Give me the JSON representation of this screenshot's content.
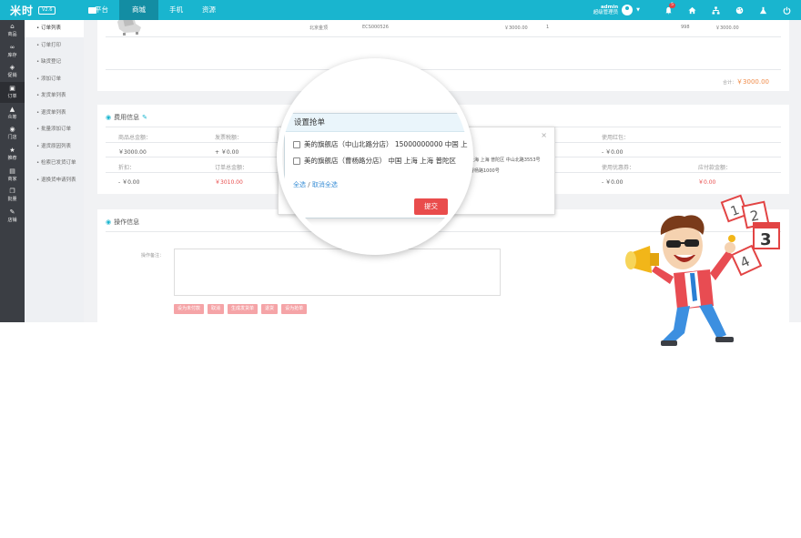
{
  "app": {
    "logo": "米时",
    "version": "V2.6"
  },
  "topnav": [
    "平台",
    "商城",
    "手机",
    "资源"
  ],
  "topnav_active": 1,
  "user": {
    "name": "admin",
    "role": "超级管理员",
    "notification_count": "5"
  },
  "sidebar": [
    {
      "label": "商品",
      "icon": "home-icon"
    },
    {
      "label": "库存",
      "icon": "link-icon"
    },
    {
      "label": "促销",
      "icon": "tag-icon"
    },
    {
      "label": "订单",
      "icon": "clipboard-icon"
    },
    {
      "label": "众筹",
      "icon": "triangle-icon"
    },
    {
      "label": "门店",
      "icon": "location-icon"
    },
    {
      "label": "推荐",
      "icon": "star-icon"
    },
    {
      "label": "商家",
      "icon": "store-icon"
    },
    {
      "label": "批量",
      "icon": "copy-icon"
    },
    {
      "label": "店铺",
      "icon": "brush-icon"
    }
  ],
  "submenu": [
    "订单列表",
    "订单打印",
    "缺货登记",
    "添加订单",
    "发货单列表",
    "退货单列表",
    "批量添加订单",
    "退货原因列表",
    "检索已发货订单",
    "退换货申请列表"
  ],
  "product": {
    "brand": "北京金顶",
    "sku": "ECS000526",
    "price": "￥3000.00",
    "qty": "1",
    "stock": "998",
    "subtotal": "￥3000.00"
  },
  "total": {
    "label": "合计：",
    "value": "￥3000.00"
  },
  "fee_section": {
    "title": "费用信息",
    "row1_labels": [
      "商品总金额：",
      "发票税额：",
      "",
      "",
      "",
      "使用红包："
    ],
    "row1_values": [
      "￥3000.00",
      "+ ￥0.00",
      "",
      "",
      "",
      "- ￥0.00"
    ],
    "row2_labels": [
      "折扣：",
      "订单总金额：",
      "",
      "",
      "使用积分：",
      "使用优惠券：",
      "应付款金额："
    ],
    "row2_values": [
      "- ￥0.00",
      "￥3010.00",
      "",
      "",
      "",
      "- ￥0.00",
      "￥0.00"
    ]
  },
  "op_section": {
    "title": "操作信息",
    "note_label": "操作备注：",
    "buttons": [
      "设为未付款",
      "取消",
      "生成发货单",
      "退货",
      "设为抢单"
    ]
  },
  "dialog": {
    "title": "设置抢单",
    "options": [
      "美的旗舰店（中山北路分店） 15000000000  中国 上",
      "美的旗舰店（曹杨路分店）   中国 上海 上海 普陀区"
    ],
    "select_all": "全选",
    "separator": "/",
    "deselect_all": "取消全选",
    "submit": "提交",
    "addr_line1": "上海 上海 普陀区 中山北路3553号",
    "addr_line2": "曹杨路1000号"
  }
}
